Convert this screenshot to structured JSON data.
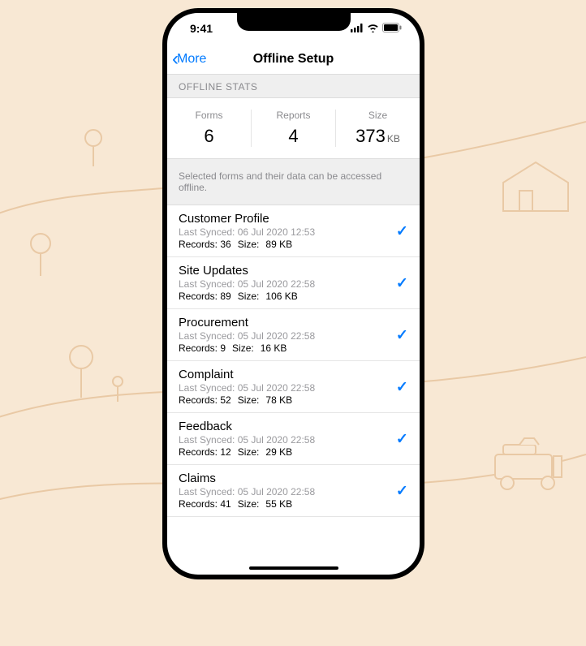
{
  "status": {
    "time": "9:41"
  },
  "nav": {
    "back_label": "More",
    "title": "Offline Setup"
  },
  "section": {
    "header": "OFFLINE STATS"
  },
  "stats": {
    "forms_label": "Forms",
    "forms_value": "6",
    "reports_label": "Reports",
    "reports_value": "4",
    "size_label": "Size",
    "size_value": "373",
    "size_unit": "KB"
  },
  "info_text": "Selected forms and their data can be accessed offline.",
  "labels": {
    "last_synced": "Last Synced:",
    "records": "Records:",
    "size": "Size:"
  },
  "items": [
    {
      "title": "Customer Profile",
      "synced": "06 Jul 2020 12:53",
      "records": "36",
      "size": "89 KB",
      "selected": true
    },
    {
      "title": "Site Updates",
      "synced": "05 Jul 2020 22:58",
      "records": "89",
      "size": "106 KB",
      "selected": true
    },
    {
      "title": "Procurement",
      "synced": "05 Jul 2020 22:58",
      "records": "9",
      "size": "16 KB",
      "selected": true
    },
    {
      "title": "Complaint",
      "synced": "05 Jul 2020 22:58",
      "records": "52",
      "size": "78 KB",
      "selected": true
    },
    {
      "title": "Feedback",
      "synced": "05 Jul 2020 22:58",
      "records": "12",
      "size": "29 KB",
      "selected": true
    },
    {
      "title": "Claims",
      "synced": "05 Jul 2020 22:58",
      "records": "41",
      "size": "55 KB",
      "selected": true
    }
  ]
}
